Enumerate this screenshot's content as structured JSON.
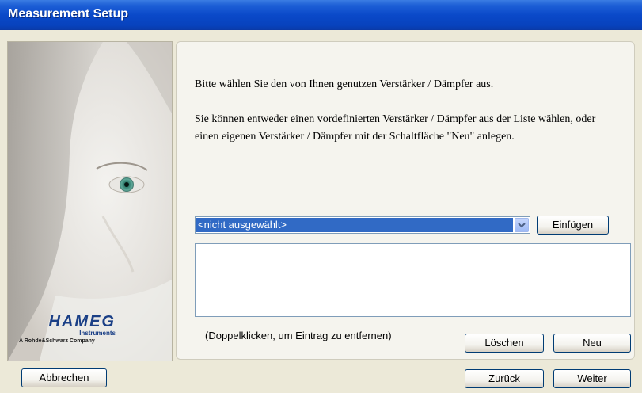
{
  "window": {
    "title": "Measurement Setup"
  },
  "logo": {
    "brand": "HAMEG",
    "subline": "Instruments",
    "tagline": "A Rohde&Schwarz Company"
  },
  "intro": {
    "line1": "Bitte wählen Sie den von Ihnen genutzen Verstärker / Dämpfer aus.",
    "line2": "Sie können entweder einen vordefinierten Verstärker / Dämpfer aus der Liste wählen, oder einen eigenen Verstärker / Dämpfer mit der Schaltfläche \"Neu\" anlegen."
  },
  "selector": {
    "selected_value": "<nicht ausgewählt>",
    "insert_label": "Einfügen"
  },
  "list": {
    "items": [],
    "hint": "(Doppelklicken, um Eintrag zu entfernen)"
  },
  "buttons": {
    "delete_label": "Löschen",
    "new_label": "Neu",
    "cancel_label": "Abbrechen",
    "back_label": "Zurück",
    "next_label": "Weiter"
  },
  "colors": {
    "titlebar": "#0a49c9",
    "selection": "#316ac5",
    "background": "#ece9d8",
    "panel": "#f5f4ee"
  }
}
